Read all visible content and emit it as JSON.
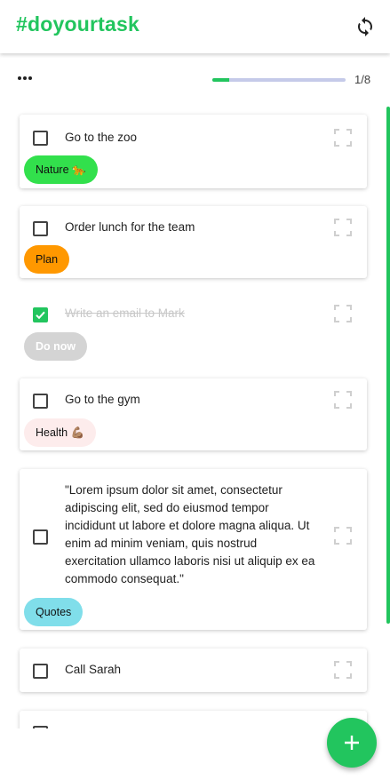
{
  "app": {
    "title": "#doyourtask",
    "brand_color": "#22c55e"
  },
  "toolbar": {
    "sync_icon": "sync-icon",
    "more_icon": "more-horizontal-icon"
  },
  "progress": {
    "completed": 1,
    "total": 8,
    "label": "1/8",
    "fraction": 0.125
  },
  "tasks": [
    {
      "text": "Go to the zoo",
      "done": false,
      "tag": "Nature 🐆",
      "tag_color": "#32e04c",
      "tag_text_color": "#111111"
    },
    {
      "text": "Order lunch for the team",
      "done": false,
      "tag": "Plan",
      "tag_color": "#ff9800",
      "tag_text_color": "#111111"
    },
    {
      "text": "Write an email to Mark",
      "done": true,
      "tag": "Do now",
      "tag_color": "#d4d4d4",
      "tag_text_color": "#ffffff"
    },
    {
      "text": "Go to the gym",
      "done": false,
      "tag": "Health 💪🏽",
      "tag_color": "#fdecec",
      "tag_text_color": "#111111"
    },
    {
      "text": "\"Lorem ipsum dolor sit amet, consectetur adipiscing elit, sed do eiusmod tempor incididunt ut labore et dolore magna aliqua. Ut enim ad minim veniam, quis nostrud exercitation ullamco laboris nisi ut aliquip ex ea commodo consequat.\"",
      "done": false,
      "tag": "Quotes",
      "tag_color": "#80deea",
      "tag_text_color": "#111111"
    },
    {
      "text": "Call Sarah",
      "done": false,
      "tag": null
    },
    {
      "text": "",
      "done": false,
      "tag": null
    }
  ],
  "fab": {
    "icon": "plus-icon"
  }
}
